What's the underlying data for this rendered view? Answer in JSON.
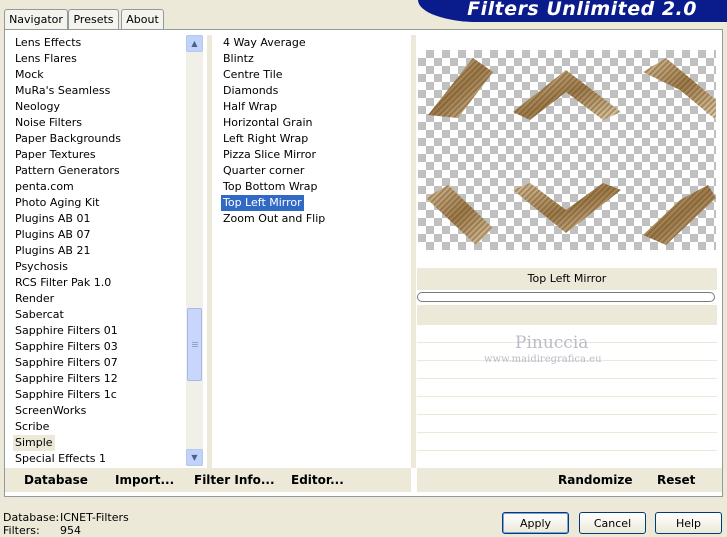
{
  "tabs": [
    "Navigator",
    "Presets",
    "About"
  ],
  "banner_title": "Filters Unlimited 2.0",
  "categories": [
    "Lens Effects",
    "Lens Flares",
    "Mock",
    "MuRa's Seamless",
    "Neology",
    "Noise Filters",
    "Paper Backgrounds",
    "Paper Textures",
    "Pattern Generators",
    "penta.com",
    "Photo Aging Kit",
    "Plugins AB 01",
    "Plugins AB 07",
    "Plugins AB 21",
    "Psychosis",
    "RCS Filter Pak 1.0",
    "Render",
    "Sabercat",
    "Sapphire Filters 01",
    "Sapphire Filters 03",
    "Sapphire Filters 07",
    "Sapphire Filters 12",
    "Sapphire Filters 1c",
    "ScreenWorks",
    "Scribe",
    "Simple",
    "Special Effects 1"
  ],
  "selected_category": "Simple",
  "filters": [
    "4 Way Average",
    "Blintz",
    "Centre Tile",
    "Diamonds",
    "Half Wrap",
    "Horizontal Grain",
    "Left Right Wrap",
    "Pizza Slice Mirror",
    "Quarter corner",
    "Top Bottom Wrap",
    "Top Left Mirror",
    "Zoom Out and Flip"
  ],
  "selected_filter": "Top Left Mirror",
  "preview_caption": "Top Left Mirror",
  "watermark": {
    "name": "Pinuccia",
    "url": "www.maidiregrafica.eu"
  },
  "bottom_buttons": {
    "database": "Database",
    "import": "Import...",
    "filter_info": "Filter Info...",
    "editor": "Editor...",
    "randomize": "Randomize",
    "reset": "Reset"
  },
  "status": {
    "database_label": "Database:",
    "database_value": "ICNET-Filters",
    "filters_label": "Filters:",
    "filters_value": "954"
  },
  "actions": {
    "apply": "Apply",
    "cancel": "Cancel",
    "help": "Help"
  }
}
